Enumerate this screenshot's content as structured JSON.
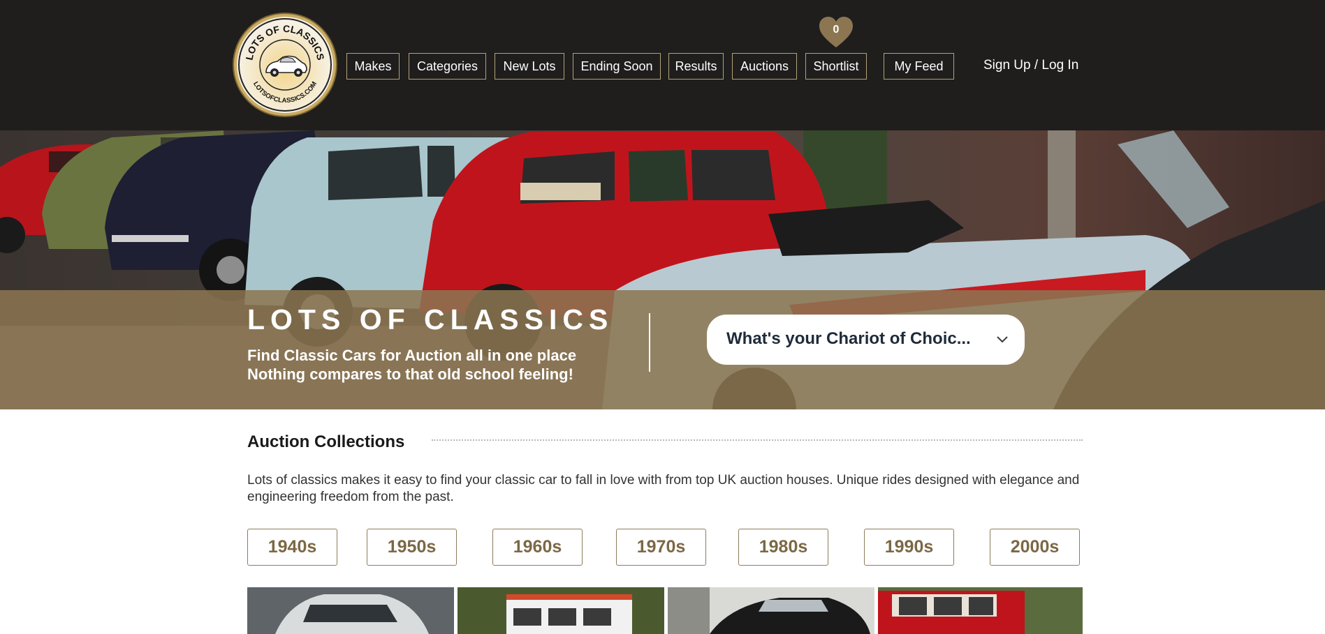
{
  "header": {
    "logo": {
      "alt": "Lots of Classics logo",
      "top_text": "LOTS OF CLASSICS",
      "bottom_text": "LOTSOFCLASSICS.COM",
      "icon": "vintage-car-icon"
    },
    "nav": [
      {
        "label": "Makes"
      },
      {
        "label": "Categories"
      },
      {
        "label": "New Lots"
      },
      {
        "label": "Ending Soon"
      },
      {
        "label": "Results"
      },
      {
        "label": "Auctions"
      },
      {
        "label": "Shortlist"
      },
      {
        "label": "My Feed"
      }
    ],
    "shortlist_count": "0",
    "signin_label": "Sign Up / Log In"
  },
  "hero": {
    "title": "LOTS OF CLASSICS",
    "subtitle_line1": "Find Classic Cars for Auction all in one place",
    "subtitle_line2": "Nothing compares to that old school feeling!",
    "select_text": "What's your Chariot of Choic...",
    "select_icon": "chevron-down-icon"
  },
  "collections": {
    "title": "Auction Collections",
    "description": "Lots of classics makes it easy to find your classic car to fall in love with from top UK auction houses. Unique rides designed with elegance and engineering freedom from the past.",
    "decades": [
      "1940s",
      "1950s",
      "1960s",
      "1970s",
      "1980s",
      "1990s",
      "2000s"
    ]
  },
  "colors": {
    "header_bg": "#1f1e1d",
    "accent_gold": "#8c7652",
    "nav_border": "#b3a37a",
    "decade_text": "#7b6845"
  }
}
